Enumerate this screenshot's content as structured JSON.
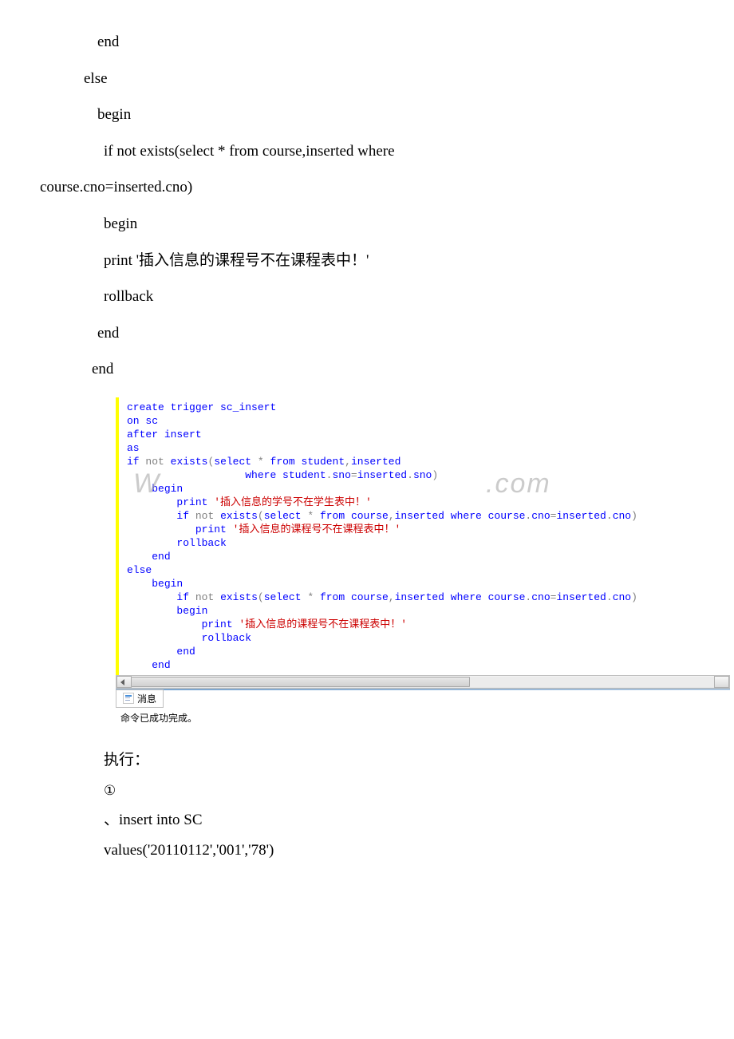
{
  "doc": {
    "lines": [
      {
        "cls": "indent2",
        "text": "end"
      },
      {
        "cls": "indent1b",
        "text": "else"
      },
      {
        "cls": "indent2",
        "text": "begin"
      },
      {
        "cls": "indent3",
        "text": "if not exists(select * from course,inserted where"
      },
      {
        "cls": "wrap-line",
        "text": "course.cno=inserted.cno)"
      },
      {
        "cls": "indent3",
        "text": "begin"
      },
      {
        "cls": "indent3",
        "text": " print '插入信息的课程号不在课程表中！'"
      },
      {
        "cls": "indent3",
        "text": " rollback"
      },
      {
        "cls": "indent2",
        "text": " end"
      },
      {
        "cls": "indent1",
        "text": " end"
      }
    ]
  },
  "sql": {
    "lines": [
      "create trigger sc_insert",
      "on sc",
      "after insert",
      "as",
      "if not exists(select * from student,inserted",
      "                   where student.sno=inserted.sno)",
      "    begin",
      "        print '插入信息的学号不在学生表中！'",
      "        if not exists(select * from course,inserted where course.cno=inserted.cno)",
      "           print '插入信息的课程号不在课程表中！'",
      "        rollback",
      "    end",
      "else",
      "    begin",
      "        if not exists(select * from course,inserted where course.cno=inserted.cno)",
      "        begin",
      "            print '插入信息的课程号不在课程表中！'",
      "            rollback",
      "        end",
      "    end"
    ],
    "msg_tab": "消息",
    "msg_text": "命令已成功完成。"
  },
  "exec": {
    "label": "执行：",
    "num": "①",
    "insert1": "、insert into SC",
    "insert2": "values('20110112','001','78')"
  },
  "watermark": {
    "w1": "W",
    "w2": ".com"
  }
}
